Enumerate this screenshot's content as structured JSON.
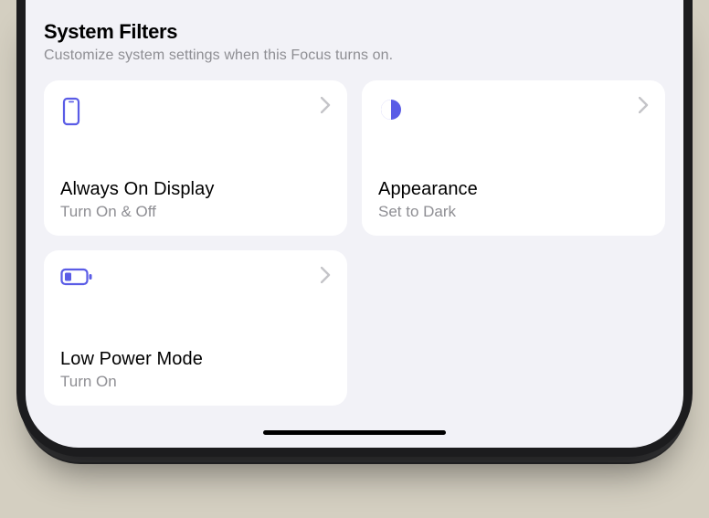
{
  "colors": {
    "accent": "#5a5ce6"
  },
  "section": {
    "title": "System Filters",
    "subtitle": "Customize system settings when this Focus turns on."
  },
  "cards": [
    {
      "icon": "phone-icon",
      "title": "Always On Display",
      "subtitle": "Turn On & Off"
    },
    {
      "icon": "contrast-icon",
      "title": "Appearance",
      "subtitle": "Set to Dark"
    },
    {
      "icon": "battery-low-icon",
      "title": "Low Power Mode",
      "subtitle": "Turn On"
    }
  ]
}
